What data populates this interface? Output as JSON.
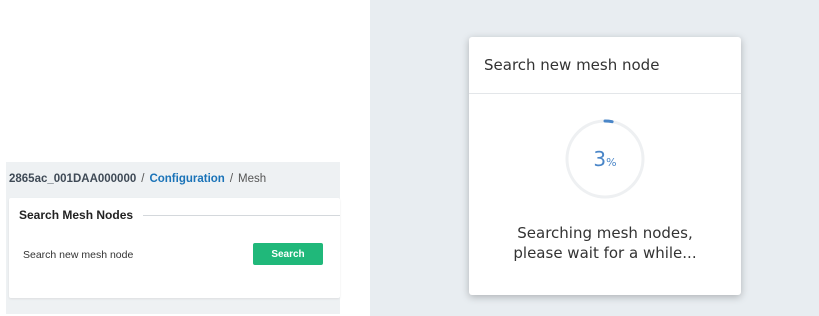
{
  "breadcrumb": {
    "device": "2865ac_001DAA000000",
    "separator": "/",
    "section": "Configuration",
    "page": "Mesh"
  },
  "card": {
    "title": "Search Mesh Nodes",
    "row_label": "Search new mesh node",
    "button_label": "Search"
  },
  "modal": {
    "title": "Search new mesh node",
    "progress_value": "3",
    "progress_unit": "%",
    "progress_fraction": 0.03,
    "status_line1": "Searching mesh nodes,",
    "status_line2": "please wait for a while..."
  },
  "colors": {
    "accent_green": "#20b87a",
    "link_blue": "#1a73b8",
    "progress_blue": "#4a86c8"
  }
}
